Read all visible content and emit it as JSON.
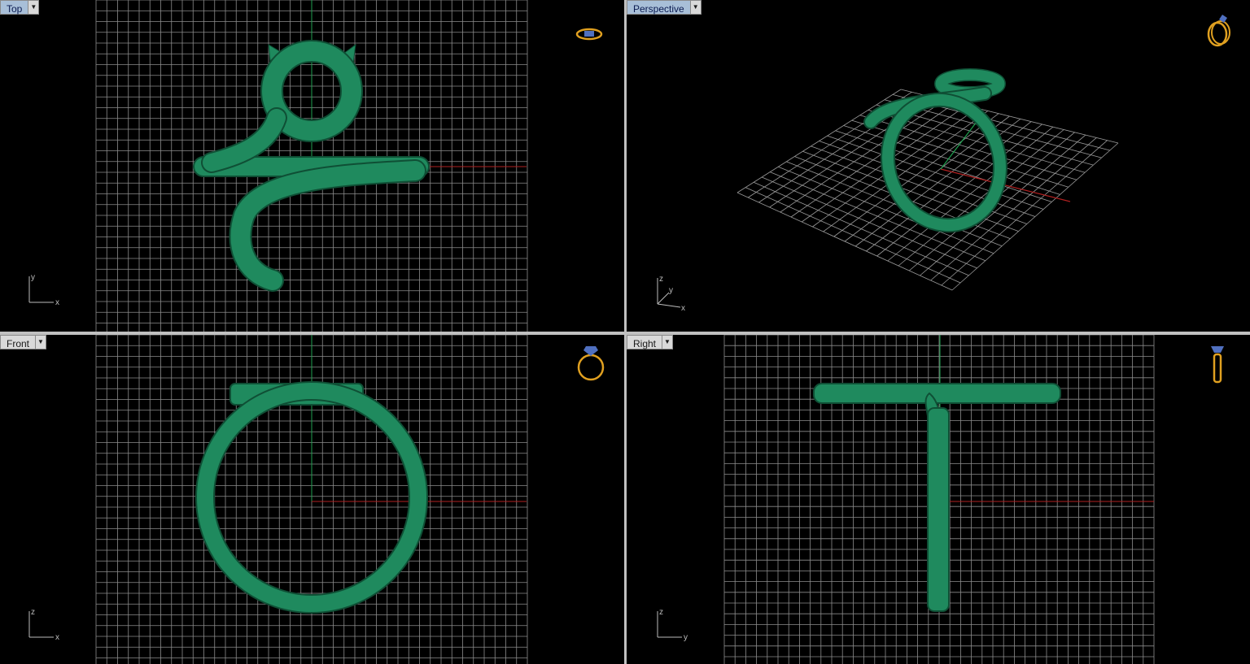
{
  "viewports": {
    "top": {
      "title": "Top",
      "axis_labels": [
        "y",
        "x"
      ]
    },
    "perspective": {
      "title": "Perspective",
      "axis_labels": [
        "z",
        "y",
        "x"
      ]
    },
    "front": {
      "title": "Front",
      "axis_labels": [
        "z",
        "x"
      ]
    },
    "right": {
      "title": "Right",
      "axis_labels": [
        "z",
        "y"
      ]
    }
  },
  "colors": {
    "background": "#000000",
    "grid": "#9a9a9a",
    "model": "#1f8a5e",
    "model_edge": "#0f4f35",
    "x_axis": "#b02020",
    "y_axis": "#20a050",
    "icon": "#e0a020"
  },
  "icons": {
    "top": "ring-top-view-icon",
    "perspective": "ring-perspective-icon",
    "front": "ring-front-view-icon",
    "right": "ring-side-view-icon"
  }
}
